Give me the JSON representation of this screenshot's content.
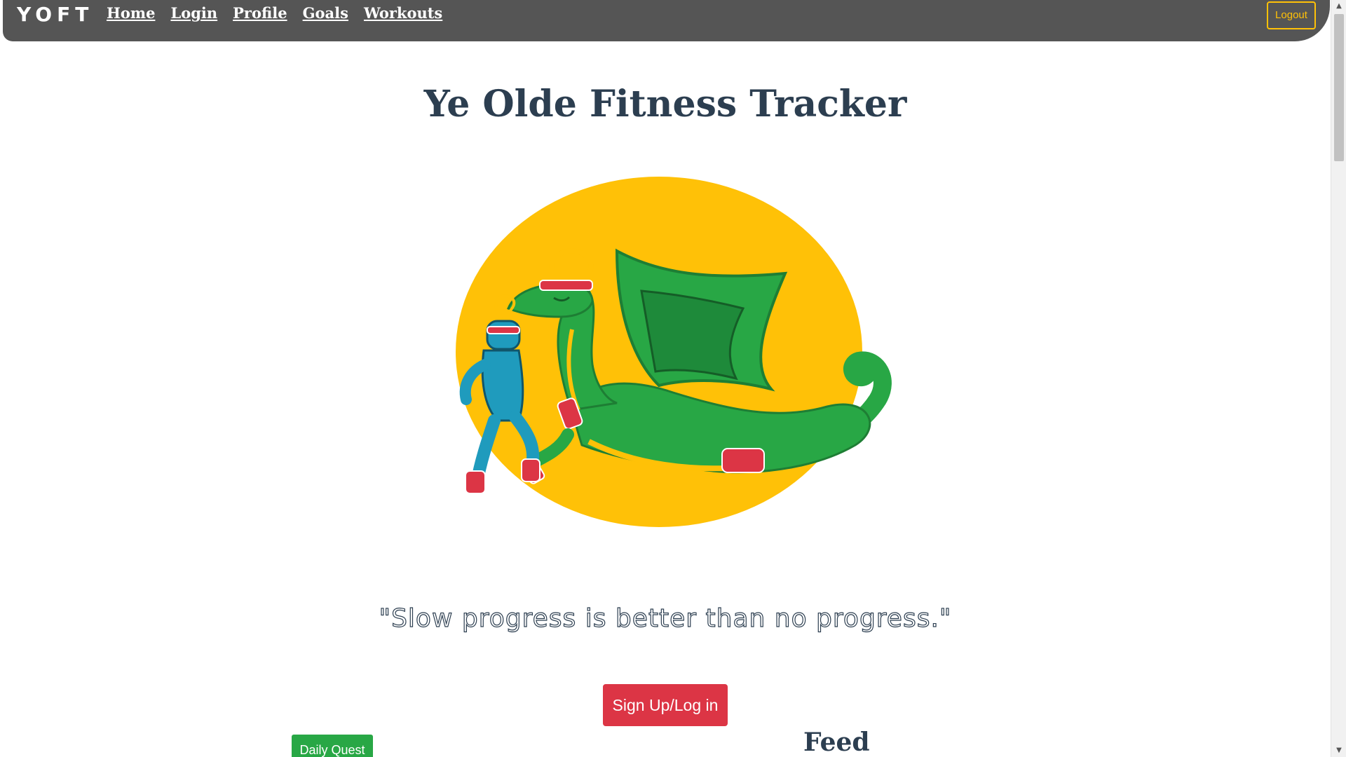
{
  "nav": {
    "brand": "YOFT",
    "links": [
      "Home",
      "Login",
      "Profile",
      "Goals",
      "Workouts"
    ],
    "logout_label": "Logout"
  },
  "main": {
    "title": "Ye Olde Fitness Tracker",
    "quote": "\"Slow progress is better than no progress.\"",
    "signup_label": "Sign Up/Log in",
    "daily_quest_label": "Daily Quest",
    "feed_heading": "Feed"
  },
  "colors": {
    "navbar": "#555555",
    "accent_yellow": "#ffc107",
    "title_text": "#2c3e50",
    "signup_red": "#dc3545",
    "quest_green": "#28a745",
    "dragon_green": "#28a745"
  },
  "icons": {
    "scroll_up": "triangle-up",
    "scroll_down": "triangle-down"
  }
}
